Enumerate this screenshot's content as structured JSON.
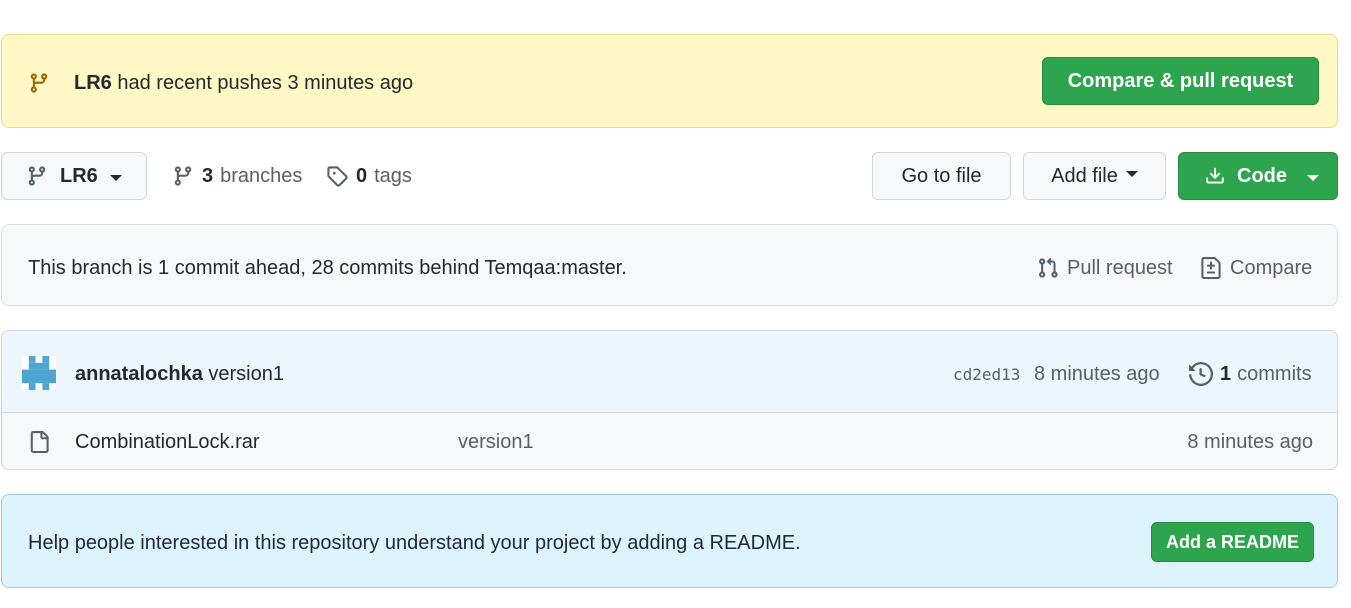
{
  "flash": {
    "branch": "LR6",
    "message": "had recent pushes 3 minutes ago",
    "button": "Compare & pull request"
  },
  "toolbar": {
    "branch_selector": "LR6",
    "branches_count": "3",
    "branches_label": "branches",
    "tags_count": "0",
    "tags_label": "tags",
    "go_to_file": "Go to file",
    "add_file": "Add file",
    "code": "Code"
  },
  "ahead_behind": {
    "text": "This branch is 1 commit ahead, 28 commits behind Temqaa:master.",
    "pull_request": "Pull request",
    "compare": "Compare"
  },
  "latest_commit": {
    "author": "annatalochka",
    "message": "version1",
    "sha": "cd2ed13",
    "time": "8 minutes ago",
    "commits_count": "1",
    "commits_label": "commits"
  },
  "files": [
    {
      "name": "CombinationLock.rar",
      "message": "version1",
      "time": "8 minutes ago"
    }
  ],
  "readme_prompt": {
    "text": "Help people interested in this repository understand your project by adding a README.",
    "button": "Add a README"
  },
  "colors": {
    "green": "#2da44e",
    "flash_bg": "#fff8c5",
    "readme_bg": "#ddf4ff",
    "avatar": "#4fa5cf"
  }
}
